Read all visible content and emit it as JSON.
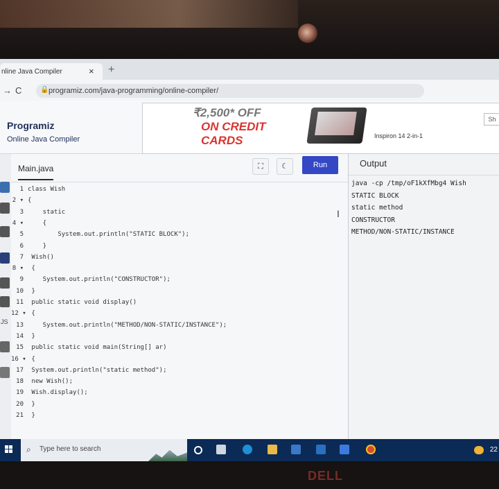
{
  "browser": {
    "tab_title": "nline Java Compiler",
    "tab_close": "×",
    "new_tab": "+",
    "url": "programiz.com/java-programming/online-compiler/"
  },
  "site": {
    "logo": "Programiz",
    "subtitle": "Online Java Compiler"
  },
  "ad": {
    "price": "₹2,500* OFF",
    "line2": "ON CREDIT",
    "line3": "CARDS",
    "model": "Inspiron 14 2-in-1",
    "cutoff_button": "Sh"
  },
  "editor": {
    "file_tab": "Main.java",
    "run_label": "Run",
    "lines": [
      {
        "n": "1",
        "t": "class Wish"
      },
      {
        "n": "2 ▾",
        "t": "{"
      },
      {
        "n": "3",
        "t": "    static"
      },
      {
        "n": "4 ▾",
        "t": "    {"
      },
      {
        "n": "5",
        "t": "        System.out.println(\"STATIC BLOCK\");"
      },
      {
        "n": "6",
        "t": "    }"
      },
      {
        "n": "7",
        "t": " Wish()"
      },
      {
        "n": "8 ▾",
        "t": " {"
      },
      {
        "n": "9",
        "t": "    System.out.println(\"CONSTRUCTOR\");"
      },
      {
        "n": "10",
        "t": " }"
      },
      {
        "n": "11",
        "t": " public static void display()"
      },
      {
        "n": "12 ▾",
        "t": " {"
      },
      {
        "n": "13",
        "t": "    System.out.println(\"METHOD/NON-STATIC/INSTANCE\");"
      },
      {
        "n": "14",
        "t": " }"
      },
      {
        "n": "15",
        "t": " public static void main(String[] ar)"
      },
      {
        "n": "16 ▾",
        "t": " {"
      },
      {
        "n": "17",
        "t": " System.out.println(\"static method\");"
      },
      {
        "n": "18",
        "t": " new Wish();"
      },
      {
        "n": "19",
        "t": " Wish.display();"
      },
      {
        "n": "20",
        "t": " }"
      },
      {
        "n": "21",
        "t": " }"
      }
    ]
  },
  "output": {
    "title": "Output",
    "lines": [
      "java -cp /tmp/oF1kXfMbg4 Wish",
      "STATIC BLOCK",
      "static method",
      "CONSTRUCTOR",
      "METHOD/NON-STATIC/INSTANCE"
    ]
  },
  "taskbar": {
    "search_placeholder": "Type here to search",
    "clock": "22"
  },
  "brand": "DELL"
}
